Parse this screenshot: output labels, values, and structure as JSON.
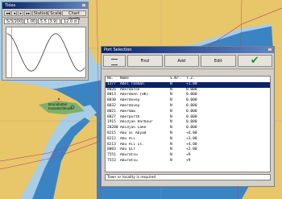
{
  "tide_window": {
    "title": "Tides",
    "toolbar": [
      "◂◂",
      "◂",
      "▸",
      "▸▸",
      "Station",
      "Scale",
      "Chart depth"
    ],
    "date": "5/3/2002",
    "time": "1:00",
    "height": "5.5 (3.9)",
    "depth": "12.0 d"
  },
  "map": {
    "label": "Brunsbüttel\nKanalschleuse"
  },
  "port_window": {
    "title": "Port Selection",
    "buttons": {
      "find": "Find",
      "add": "Add",
      "edit": "Edit"
    },
    "columns": [
      "No.",
      "Name",
      "S.Nr.",
      "T.Z."
    ],
    "rows": [
      [
        "1377",
        "Abel Tasman",
        "N",
        "+1.00"
      ],
      [
        "8026",
        "Aberdaron",
        "N",
        "0.000"
      ],
      [
        "8013",
        "Aberdeen (UK)",
        "N",
        "0.000"
      ],
      [
        "8030",
        "Aberdovey",
        "N",
        "0.000"
      ],
      [
        "8032",
        "Aberdovey",
        "N",
        "0.000"
      ],
      [
        "8021",
        "Abermaw",
        "N",
        "0.000"
      ],
      [
        "8027",
        "Aberporth",
        "N",
        "0.000"
      ],
      [
        "1915",
        "Abidjan Harbour",
        "N",
        "0.000"
      ],
      [
        "20280",
        "Abidjan Lake",
        "N",
        "0.000"
      ],
      [
        "8215",
        "Abu al Abyad",
        "N",
        "+4.00"
      ],
      [
        "8212",
        "Abu Ali",
        "N",
        "+3.00"
      ],
      [
        "8213",
        "Abu Ali Is.",
        "N",
        "+4.00"
      ],
      [
        "8003",
        "Abu Qir",
        "N",
        "+2.00"
      ],
      [
        "7551",
        "Aburatsu",
        "N",
        "+9"
      ],
      [
        "7553",
        "Aburatsu",
        "N",
        "+9"
      ]
    ],
    "status": "Town or locality is required"
  },
  "colors": {
    "sea": "#3a84c4",
    "land": "#e8c66a",
    "shallow": "#a8cde6",
    "tide_curve": "#333333"
  }
}
